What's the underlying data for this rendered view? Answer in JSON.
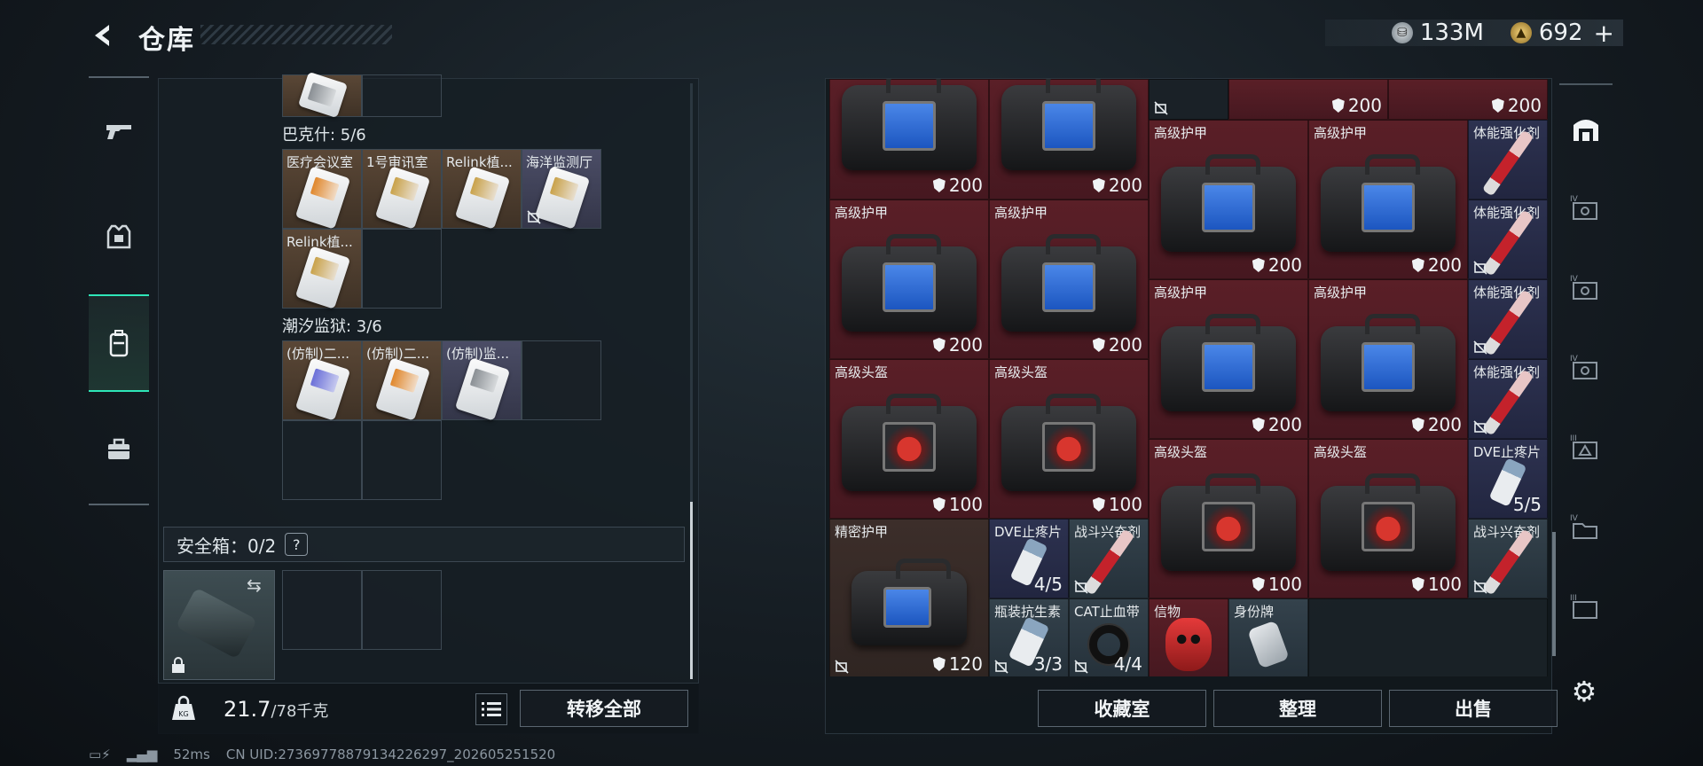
{
  "header": {
    "title": "仓库",
    "currency_silver": "133M",
    "currency_gold": "692",
    "plus": "+"
  },
  "left": {
    "groups": [
      {
        "label": "巴克什: 5/6",
        "items": [
          "医疗会议室",
          "1号审讯室",
          "Relink植...",
          "海洋监测厅",
          "Relink植..."
        ]
      },
      {
        "label": "潮汐监狱: 3/6",
        "items": [
          "(仿制)二...",
          "(仿制)二...",
          "(仿制)监..."
        ]
      }
    ],
    "safebox": {
      "label": "安全箱：0/2",
      "help": "?"
    },
    "weight": {
      "value": "21.7",
      "max": "/78千克"
    },
    "transfer_all": "转移全部"
  },
  "right": {
    "cells": [
      {
        "name": "",
        "count": "200"
      },
      {
        "name": "",
        "count": "200"
      },
      {
        "name": "",
        "count": "200"
      },
      {
        "name": "",
        "count": "200"
      },
      {
        "name": "高级护甲",
        "count": "200"
      },
      {
        "name": "高级护甲",
        "count": "200"
      },
      {
        "name": "体能强化剂",
        "count": ""
      },
      {
        "name": "高级护甲",
        "count": "200"
      },
      {
        "name": "高级护甲",
        "count": "200"
      },
      {
        "name": "体能强化剂",
        "count": ""
      },
      {
        "name": "高级护甲",
        "count": "200"
      },
      {
        "name": "高级护甲",
        "count": "200"
      },
      {
        "name": "体能强化剂",
        "count": ""
      },
      {
        "name": "高级护甲",
        "count": "200"
      },
      {
        "name": "高级护甲",
        "count": "200"
      },
      {
        "name": "体能强化剂",
        "count": ""
      },
      {
        "name": "高级头盔",
        "count": "100"
      },
      {
        "name": "高级头盔",
        "count": "100"
      },
      {
        "name": "高级头盔",
        "count": "100"
      },
      {
        "name": "高级头盔",
        "count": "100"
      },
      {
        "name": "DVE止疼片",
        "count": "5/5"
      },
      {
        "name": "精密护甲",
        "count": "120"
      },
      {
        "name": "DVE止疼片",
        "count": "4/5"
      },
      {
        "name": "战斗兴奋剂",
        "count": ""
      },
      {
        "name": "战斗兴奋剂",
        "count": ""
      },
      {
        "name": "瓶装抗生素",
        "count": "3/3"
      },
      {
        "name": "CAT止血带",
        "count": "4/4"
      },
      {
        "name": "信物",
        "count": ""
      },
      {
        "name": "身份牌",
        "count": ""
      }
    ],
    "buttons": {
      "collection": "收藏室",
      "sort": "整理",
      "sell": "出售"
    }
  },
  "status": {
    "ping": "52ms",
    "uid": "CN UID:2736977887913422629​7_202605251520"
  },
  "colors": {
    "accent": "#2ee6b8",
    "rarity_red": "#5a1f27",
    "rarity_orange": "#5a4736",
    "rarity_purple": "#4b4d66"
  }
}
